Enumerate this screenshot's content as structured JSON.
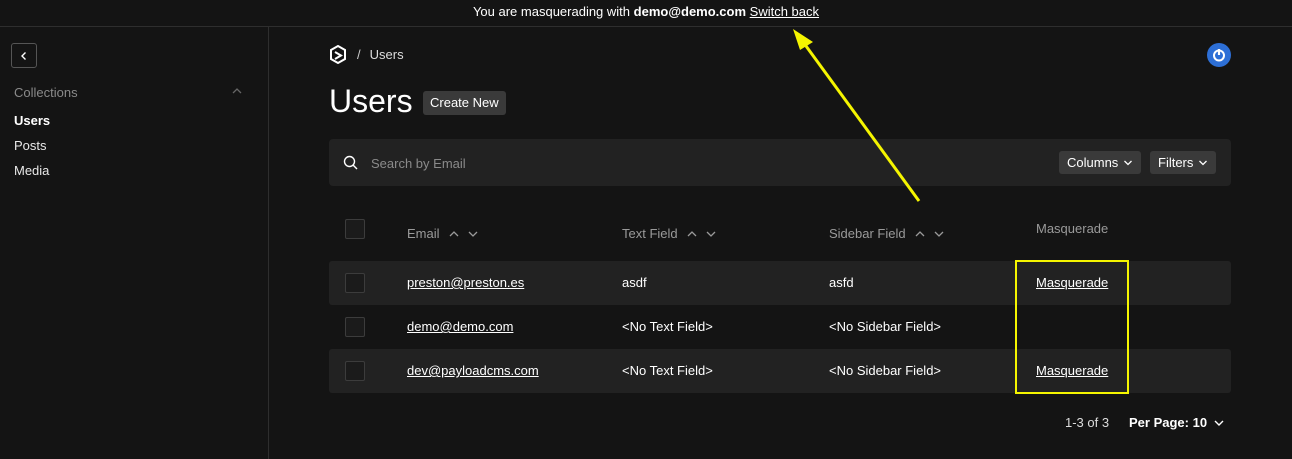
{
  "banner": {
    "prefix": "You are masquerading with",
    "user": "demo@demo.com",
    "switch_back": "Switch back"
  },
  "sidebar": {
    "group_label": "Collections",
    "items": [
      {
        "label": "Users",
        "active": true
      },
      {
        "label": "Posts",
        "active": false
      },
      {
        "label": "Media",
        "active": false
      }
    ]
  },
  "breadcrumb": {
    "separator": "/",
    "current": "Users"
  },
  "page": {
    "title": "Users",
    "create_label": "Create New"
  },
  "search": {
    "placeholder": "Search by Email",
    "columns_label": "Columns",
    "filters_label": "Filters"
  },
  "table": {
    "headers": [
      "Email",
      "Text Field",
      "Sidebar Field",
      "Masquerade"
    ],
    "rows": [
      {
        "email": "preston@preston.es",
        "text_field": "asdf",
        "sidebar_field": "asfd",
        "masquerade": "Masquerade"
      },
      {
        "email": "demo@demo.com",
        "text_field": "<No Text Field>",
        "sidebar_field": "<No Sidebar Field>",
        "masquerade": ""
      },
      {
        "email": "dev@payloadcms.com",
        "text_field": "<No Text Field>",
        "sidebar_field": "<No Sidebar Field>",
        "masquerade": "Masquerade"
      }
    ]
  },
  "pagination": {
    "info": "1-3 of 3",
    "per_page": "Per Page: 10"
  },
  "colors": {
    "background": "#141414",
    "row_shade": "#222222",
    "annotation": "#f5f500",
    "account_icon": "#2d6fd6"
  }
}
